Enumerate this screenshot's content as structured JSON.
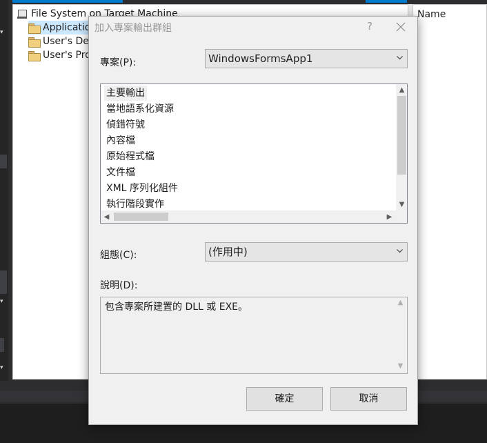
{
  "ide": {
    "tree": {
      "root_label": "File System on Target Machine",
      "items": [
        {
          "label": "Applicatio",
          "selected": true
        },
        {
          "label": "User's Des",
          "selected": false
        },
        {
          "label": "User's Pro",
          "selected": false
        }
      ]
    },
    "right_pane_header": "Name"
  },
  "dialog": {
    "title": "加入專案輸出群組",
    "help_glyph": "?",
    "project_label": "專案(P):",
    "project_value": "WindowsFormsApp1",
    "output_groups": [
      {
        "label": "主要輸出",
        "selected": true
      },
      {
        "label": "當地語系化資源",
        "selected": false
      },
      {
        "label": "偵錯符號",
        "selected": false
      },
      {
        "label": "內容檔",
        "selected": false
      },
      {
        "label": "原始程式檔",
        "selected": false
      },
      {
        "label": "文件檔",
        "selected": false
      },
      {
        "label": "XML 序列化組件",
        "selected": false
      },
      {
        "label": "執行階段實作",
        "selected": false
      }
    ],
    "configuration_label": "組態(C):",
    "configuration_value": "(作用中)",
    "description_label": "說明(D):",
    "description_text": "包含專案所建置的 DLL 或 EXE。",
    "ok_label": "確定",
    "cancel_label": "取消"
  },
  "colors": {
    "dialog_bg": "#f0f0f0",
    "ide_bg": "#2d2d30",
    "accent": "#007acc",
    "selection": "#cce8ff"
  }
}
